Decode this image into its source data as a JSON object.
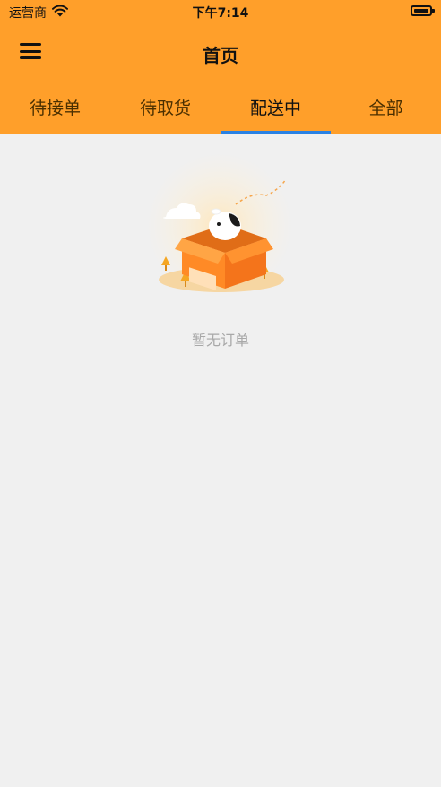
{
  "statusbar": {
    "carrier": "运营商",
    "time": "下午7:14"
  },
  "navbar": {
    "title": "首页",
    "menu_icon": "hamburger-menu-icon"
  },
  "tabs": [
    {
      "label": "待接单",
      "active": false
    },
    {
      "label": "待取货",
      "active": false
    },
    {
      "label": "配送中",
      "active": true
    },
    {
      "label": "全部",
      "active": false
    }
  ],
  "empty_state": {
    "message": "暂无订单",
    "illustration": "cow-in-box-illustration"
  },
  "colors": {
    "header": "#ff9f2a",
    "tab_indicator": "#2a82e4",
    "background": "#f0f0f0",
    "empty_text": "#a8a8a8"
  }
}
